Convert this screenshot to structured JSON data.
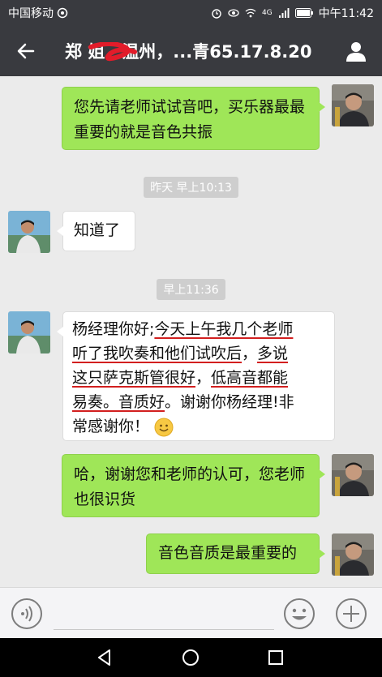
{
  "status_bar": {
    "carrier": "中国移动",
    "network": "4G",
    "time": "中午11:42"
  },
  "header": {
    "title": "郑 姐，温州，...青65.17.8.20"
  },
  "messages": [
    {
      "text": "您先请老师试试音吧，买乐器最最重要的就是音色共振"
    },
    {
      "timestamp": "昨天 早上10:13"
    },
    {
      "text": "知道了"
    },
    {
      "timestamp": "早上11:36"
    },
    {
      "lines": [
        [
          "杨经理你好;",
          "今天上午我几个老师"
        ],
        [
          "听了我吹奏和他们试吹后",
          "，",
          "多说"
        ],
        [
          "这只萨克斯管很好",
          "，",
          "低高音都能"
        ],
        [
          "易奏。音质好",
          "。谢谢你杨经理!非"
        ],
        [
          "常感谢你！"
        ]
      ]
    },
    {
      "text": "哈，谢谢您和老师的认可，您老师也很识货"
    },
    {
      "text": "音色音质是最重要的"
    }
  ],
  "input_bar": {
    "placeholder": "",
    "voice_icon": "voice-icon",
    "emoji_icon": "emoji-icon",
    "plus_icon": "plus-icon"
  },
  "colors": {
    "bar": "#393a3f",
    "chat_bg": "#ebebeb",
    "bubble_me": "#9fe658",
    "bubble_other": "#ffffff",
    "underline": "#d21f1f"
  }
}
